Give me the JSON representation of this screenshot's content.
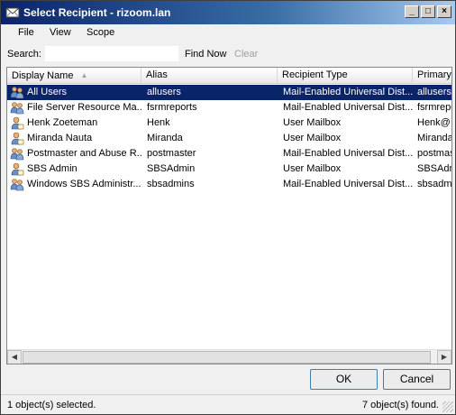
{
  "window": {
    "title": "Select Recipient - rizoom.lan",
    "minimize_glyph": "_",
    "maximize_glyph": "□",
    "close_glyph": "×"
  },
  "menu": {
    "file": "File",
    "view": "View",
    "scope": "Scope"
  },
  "search": {
    "label": "Search:",
    "value": "",
    "find_now": "Find Now",
    "clear": "Clear"
  },
  "columns": {
    "display_name": "Display Name",
    "alias": "Alias",
    "recipient_type": "Recipient Type",
    "primary": "Primary"
  },
  "rows": [
    {
      "name": "All Users",
      "alias": "allusers",
      "type": "Mail-Enabled Universal Dist...",
      "primary": "allusers@",
      "icon": "group-icon",
      "selected": true
    },
    {
      "name": "File Server Resource Ma...",
      "alias": "fsrmreports",
      "type": "Mail-Enabled Universal Dist...",
      "primary": "fsrmrepo",
      "icon": "group-icon",
      "selected": false
    },
    {
      "name": "Henk Zoeteman",
      "alias": "Henk",
      "type": "User Mailbox",
      "primary": "Henk@",
      "icon": "user-mailbox-icon",
      "selected": false
    },
    {
      "name": "Miranda Nauta",
      "alias": "Miranda",
      "type": "User Mailbox",
      "primary": "Miranda",
      "icon": "user-mailbox-icon",
      "selected": false
    },
    {
      "name": "Postmaster and Abuse R...",
      "alias": "postmaster",
      "type": "Mail-Enabled Universal Dist...",
      "primary": "postmas",
      "icon": "group-icon",
      "selected": false
    },
    {
      "name": "SBS Admin",
      "alias": "SBSAdmin",
      "type": "User Mailbox",
      "primary": "SBSAdm",
      "icon": "user-mailbox-icon",
      "selected": false
    },
    {
      "name": "Windows SBS Administr...",
      "alias": "sbsadmins",
      "type": "Mail-Enabled Universal Dist...",
      "primary": "sbsadmi",
      "icon": "group-icon",
      "selected": false
    }
  ],
  "buttons": {
    "ok": "OK",
    "cancel": "Cancel"
  },
  "status": {
    "selected": "1 object(s) selected.",
    "found": "7 object(s) found."
  },
  "colors": {
    "selection": "#0a246a",
    "title_start": "#0a246a"
  }
}
